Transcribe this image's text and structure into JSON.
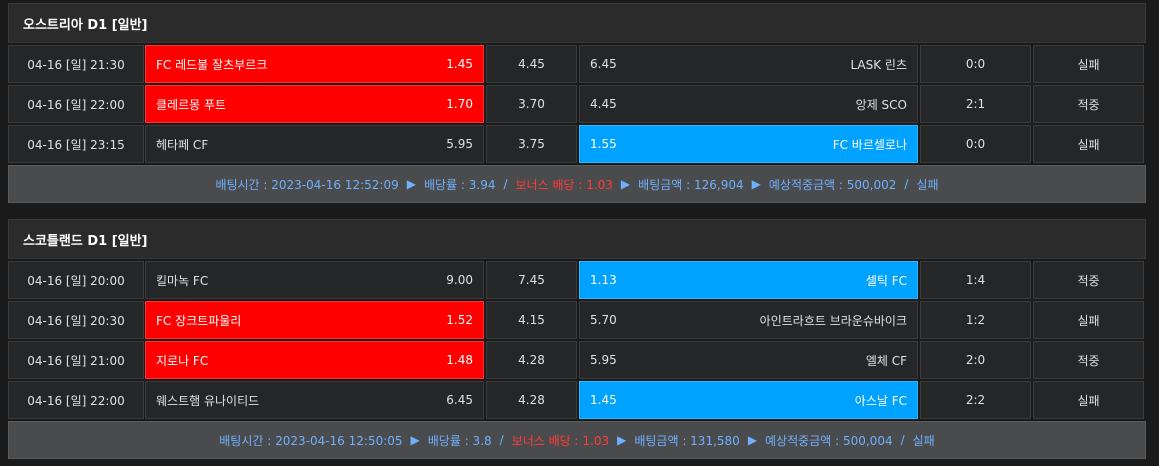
{
  "blocks": [
    {
      "title": "오스트리아 D1 [일반]",
      "rows": [
        {
          "date": "04-16 [일] 21:30",
          "home": "FC 레드불 잘츠부르크",
          "home_odds": "1.45",
          "draw": "4.45",
          "away_odds": "6.45",
          "away": "LASK 린츠",
          "score": "0:0",
          "result": "실패",
          "selected": "home"
        },
        {
          "date": "04-16 [일] 22:00",
          "home": "클레르몽 푸트",
          "home_odds": "1.70",
          "draw": "3.70",
          "away_odds": "4.45",
          "away": "앙제 SCO",
          "score": "2:1",
          "result": "적중",
          "selected": "home"
        },
        {
          "date": "04-16 [일] 23:15",
          "home": "헤타페 CF",
          "home_odds": "5.95",
          "draw": "3.75",
          "away_odds": "1.55",
          "away": "FC 바르셀로나",
          "score": "0:0",
          "result": "실패",
          "selected": "away"
        }
      ],
      "summary": {
        "bet_time": "배팅시간 : 2023-04-16 12:52:09",
        "arrow": "▶",
        "odds": "배당률 : 3.94",
        "slash": "/",
        "bonus": "보너스 배당 : 1.03",
        "amount": "배팅금액 : 126,904",
        "expected": "예상적중금액 : 500,002",
        "status": "실패"
      }
    },
    {
      "title": "스코틀랜드 D1 [일반]",
      "rows": [
        {
          "date": "04-16 [일] 20:00",
          "home": "킬마녹 FC",
          "home_odds": "9.00",
          "draw": "7.45",
          "away_odds": "1.13",
          "away": "셀틱 FC",
          "score": "1:4",
          "result": "적중",
          "selected": "away"
        },
        {
          "date": "04-16 [일] 20:30",
          "home": "FC 장크트파울리",
          "home_odds": "1.52",
          "draw": "4.15",
          "away_odds": "5.70",
          "away": "아인트라흐트 브라운슈바이크",
          "score": "1:2",
          "result": "실패",
          "selected": "home"
        },
        {
          "date": "04-16 [일] 21:00",
          "home": "지로나 FC",
          "home_odds": "1.48",
          "draw": "4.28",
          "away_odds": "5.95",
          "away": "엘체 CF",
          "score": "2:0",
          "result": "적중",
          "selected": "home"
        },
        {
          "date": "04-16 [일] 22:00",
          "home": "웨스트햄 유나이티드",
          "home_odds": "6.45",
          "draw": "4.28",
          "away_odds": "1.45",
          "away": "아스날 FC",
          "score": "2:2",
          "result": "실패",
          "selected": "away"
        }
      ],
      "summary": {
        "bet_time": "배팅시간 : 2023-04-16 12:50:05",
        "arrow": "▶",
        "odds": "배당률 : 3.8",
        "slash": "/",
        "bonus": "보너스 배당 : 1.03",
        "amount": "배팅금액 : 131,580",
        "expected": "예상적중금액 : 500,004",
        "status": "실패"
      }
    }
  ],
  "colors": {
    "selected_home": "#ff0000",
    "selected_away": "#00a2ff",
    "fail": "#4da3ff",
    "win": "#ff4d4d"
  }
}
